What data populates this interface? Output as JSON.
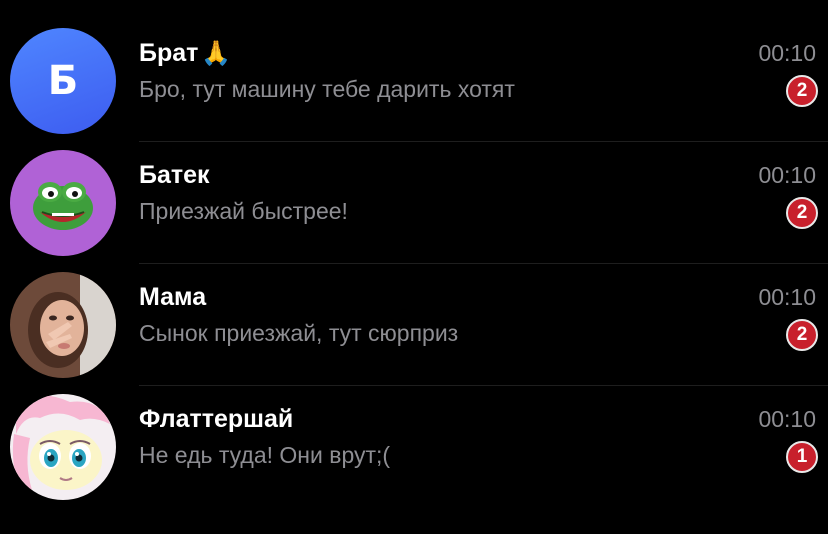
{
  "colors": {
    "background": "#000000",
    "name_text": "#ffffff",
    "secondary_text": "#8e8e93",
    "badge": "#c8202c",
    "avatar_blue": "#4f86ff"
  },
  "chats": [
    {
      "name": "Брат",
      "name_emoji": "🙏",
      "preview": "Бро, тут машину тебе дарить хотят",
      "time": "00:10",
      "unread": "2",
      "avatar": {
        "type": "letter",
        "letter": "Б"
      }
    },
    {
      "name": "Батек",
      "preview": "Приезжай быстрее!",
      "time": "00:10",
      "unread": "2",
      "avatar": {
        "type": "image",
        "icon": "pepe-frog-icon"
      }
    },
    {
      "name": "Мама",
      "preview": "Сынок приезжай, тут сюрприз",
      "time": "00:10",
      "unread": "2",
      "avatar": {
        "type": "image",
        "icon": "selfie-photo"
      }
    },
    {
      "name": "Флаттершай",
      "preview": "Не едь туда! Они врут;(",
      "time": "00:10",
      "unread": "1",
      "avatar": {
        "type": "image",
        "icon": "pony-cartoon-icon"
      }
    }
  ]
}
